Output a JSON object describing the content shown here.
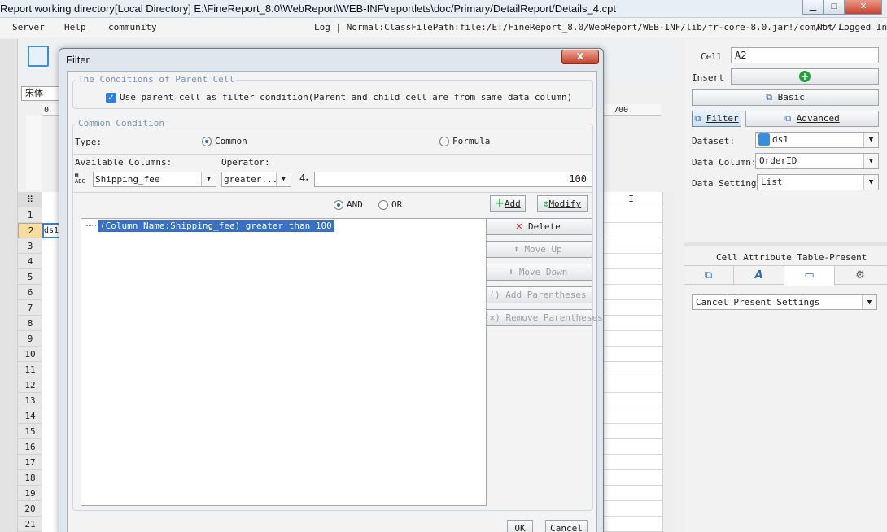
{
  "window": {
    "title": "Report working directory[Local Directory]    E:\\FineReport_8.0\\WebReport\\WEB-INF\\reportlets\\doc/Primary/DetailReport/Details_4.cpt"
  },
  "menubar": {
    "items": [
      "Server",
      "Help",
      "community"
    ],
    "log_path": "Log | Normal:ClassFilePath:file:/E:/FineReport_8.0/WebReport/WEB-INF/lib/fr-core-8.0.jar!/com/fr/...",
    "login_status": "Not Logged In"
  },
  "designer": {
    "font": "宋体",
    "ruler_start": "0",
    "ruler_700": "700",
    "column_i_header": "I",
    "selected_cell_text": "ds1",
    "row_numbers": [
      "1",
      "2",
      "3",
      "4",
      "5",
      "6",
      "7",
      "8",
      "9",
      "10",
      "11",
      "12",
      "13",
      "14",
      "15",
      "16",
      "17",
      "18",
      "19",
      "20",
      "21"
    ],
    "selected_row": "2"
  },
  "right_panel": {
    "cell_label": "Cell",
    "cell_value": "A2",
    "insert_label": "Insert",
    "basic_label": "Basic",
    "filter_label": "Filter",
    "advanced_label": "Advanced",
    "dataset_label": "Dataset:",
    "dataset_value": "ds1",
    "data_column_label": "Data Column:",
    "data_column_value": "OrderID",
    "data_setting_label": "Data Setting",
    "data_setting_value": "List",
    "attr_title": "Cell Attribute Table-Present",
    "present_value": "Cancel Present Settings"
  },
  "dialog": {
    "title": "Filter",
    "close_label": "x",
    "parent_group_title": "The Conditions of Parent Cell",
    "parent_checkbox_label": "Use parent cell as filter condition(Parent and child cell are from same data column)",
    "common_group_title": "Common Condition",
    "type_label": "Type:",
    "type_common": "Common",
    "type_formula": "Formula",
    "available_columns_label": "Available Columns:",
    "operator_label": "Operator:",
    "column_value": "Shipping_fee",
    "column_icon_text": "ABC",
    "operator_value": "greater...",
    "value_type": "4",
    "value_input": "100",
    "and_label": "AND",
    "or_label": "OR",
    "add_label": "Add",
    "modify_label": "Modify",
    "condition_item": "(Column Name:Shipping_fee) greater than 100",
    "delete_label": "Delete",
    "move_up_label": "Move Up",
    "move_down_label": "Move Down",
    "add_paren_label": "Add Parentheses",
    "remove_paren_label": "Remove Parentheses",
    "ok_label": "OK",
    "cancel_label": "Cancel"
  },
  "colors": {
    "accent": "#3670c8",
    "group_title": "#7a94ba",
    "delete_icon": "#d9322a",
    "add_icon": "#22a53b"
  }
}
